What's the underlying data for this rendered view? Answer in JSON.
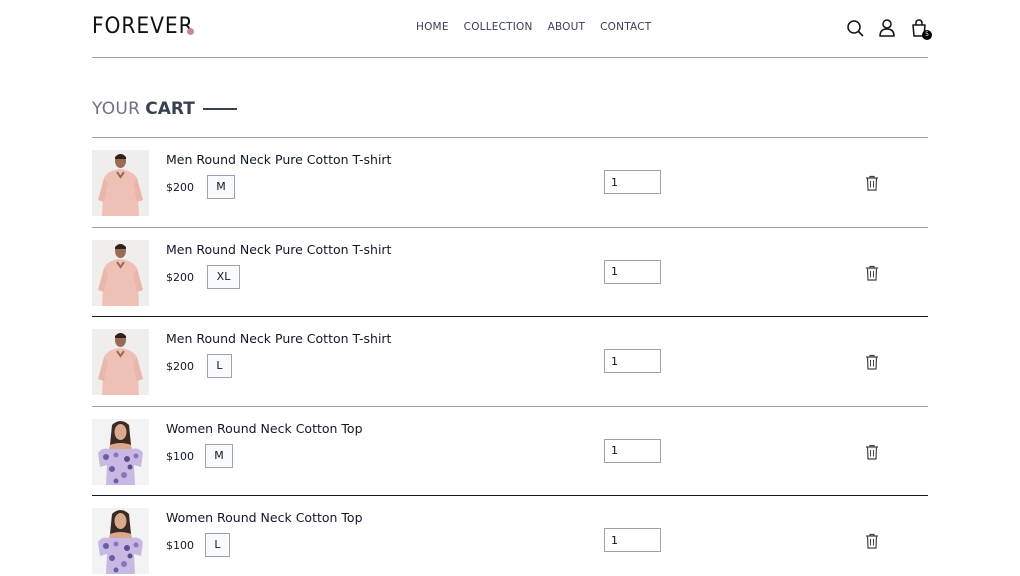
{
  "brand": {
    "name": "FOREVER",
    "dot_color": "#c586a5"
  },
  "nav": [
    {
      "label": "HOME"
    },
    {
      "label": "COLLECTION"
    },
    {
      "label": "ABOUT"
    },
    {
      "label": "CONTACT"
    }
  ],
  "header_icons": {
    "search": "search-icon",
    "profile": "user-icon",
    "cart": "shopping-bag-icon",
    "cart_count": "5"
  },
  "page_title": {
    "prefix": "YOUR",
    "main": "CART"
  },
  "cart_items": [
    {
      "name": "Men Round Neck Pure Cotton T-shirt",
      "price": "$200",
      "size": "M",
      "qty": "1",
      "image": "man-pink-shirt"
    },
    {
      "name": "Men Round Neck Pure Cotton T-shirt",
      "price": "$200",
      "size": "XL",
      "qty": "1",
      "image": "man-pink-shirt"
    },
    {
      "name": "Men Round Neck Pure Cotton T-shirt",
      "price": "$200",
      "size": "L",
      "qty": "1",
      "image": "man-pink-shirt"
    },
    {
      "name": "Women Round Neck Cotton Top",
      "price": "$100",
      "size": "M",
      "qty": "1",
      "image": "woman-floral-top"
    },
    {
      "name": "Women Round Neck Cotton Top",
      "price": "$100",
      "size": "L",
      "qty": "1",
      "image": "woman-floral-top"
    }
  ]
}
